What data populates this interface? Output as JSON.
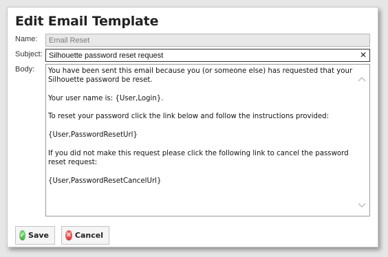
{
  "dialog": {
    "title": "Edit Email Template"
  },
  "form": {
    "name_label": "Name:",
    "name_value": "Email Reset",
    "subject_label": "Subject:",
    "subject_value": "Silhouette password reset request",
    "body_label": "Body:",
    "body_value": "You have been sent this email because you (or someone else) has requested that your\nSilhouette password be reset.\n\nYour user name is: {User,Login}.\n\nTo reset your password click the link below and follow the instructions provided:\n\n{User,PasswordResetUrl}\n\nIf you did not make this request please click the following link to cancel the password\nreset request:\n\n{User,PasswordResetCancelUrl}"
  },
  "icons": {
    "clear": "close-icon",
    "scroll_up": "chevron-up-icon",
    "scroll_down": "chevron-down-icon",
    "save": "check-circle-icon",
    "cancel": "x-circle-icon"
  },
  "buttons": {
    "save_label": "Save",
    "cancel_label": "Cancel"
  },
  "colors": {
    "save_accent": "#2f9e2b",
    "cancel_accent": "#cc1a1a"
  }
}
